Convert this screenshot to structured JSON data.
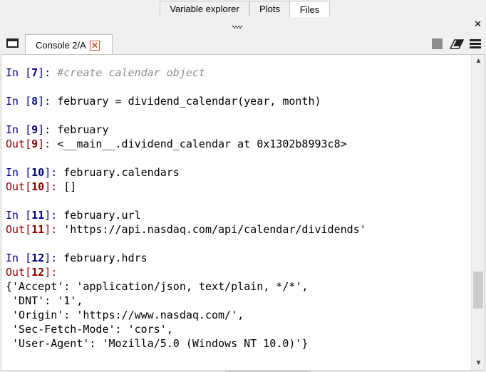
{
  "top_tabs": [
    {
      "label": "Variable explorer"
    },
    {
      "label": "Plots"
    },
    {
      "label": "Files"
    }
  ],
  "console": {
    "tab_label": "Console 2/A",
    "lines": [
      {
        "kind": "in",
        "num": "7",
        "text": "#create calendar object",
        "comment": true
      },
      {
        "kind": "blank"
      },
      {
        "kind": "in",
        "num": "8",
        "text": "february = dividend_calendar(year, month)"
      },
      {
        "kind": "blank"
      },
      {
        "kind": "in",
        "num": "9",
        "text": "february"
      },
      {
        "kind": "out",
        "num": "9",
        "text": "<__main__.dividend_calendar at 0x1302b8993c8>"
      },
      {
        "kind": "blank"
      },
      {
        "kind": "in",
        "num": "10",
        "text": "february.calendars"
      },
      {
        "kind": "out",
        "num": "10",
        "text": "[]"
      },
      {
        "kind": "blank"
      },
      {
        "kind": "in",
        "num": "11",
        "text": "february.url"
      },
      {
        "kind": "out",
        "num": "11",
        "text": "'https://api.nasdaq.com/api/calendar/dividends'"
      },
      {
        "kind": "blank"
      },
      {
        "kind": "in",
        "num": "12",
        "text": "february.hdrs"
      },
      {
        "kind": "out",
        "num": "12",
        "text": ""
      },
      {
        "kind": "plain",
        "text": "{'Accept': 'application/json, text/plain, */*',"
      },
      {
        "kind": "plain",
        "text": " 'DNT': '1',"
      },
      {
        "kind": "plain",
        "text": " 'Origin': 'https://www.nasdaq.com/',"
      },
      {
        "kind": "plain",
        "text": " 'Sec-Fetch-Mode': 'cors',"
      },
      {
        "kind": "plain",
        "text": " 'User-Agent': 'Mozilla/5.0 (Windows NT 10.0)'}"
      }
    ]
  },
  "icons": {
    "pane_close": "close-icon",
    "tab_close": "close-icon",
    "browse": "browse-tabs-icon",
    "stop": "stop-icon",
    "clear": "eraser-icon",
    "options": "hamburger-menu-icon"
  }
}
